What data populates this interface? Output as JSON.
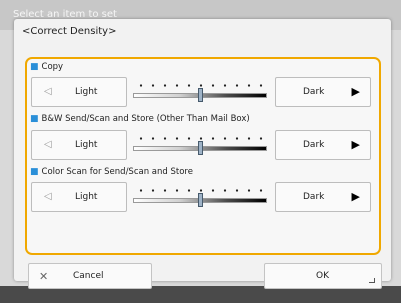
{
  "background": {
    "text": "Select an item to set"
  },
  "dialog": {
    "title": "<Correct Density>"
  },
  "sections": [
    {
      "label": "Copy",
      "light_label": "Light",
      "dark_label": "Dark",
      "level": 0.5
    },
    {
      "label": "B&W Send/Scan and Store (Other Than Mail Box)",
      "light_label": "Light",
      "dark_label": "Dark",
      "level": 0.5
    },
    {
      "label": "Color Scan for Send/Scan and Store",
      "light_label": "Light",
      "dark_label": "Dark",
      "level": 0.5
    }
  ],
  "icons": {
    "light": "light-icon",
    "dark": "dark-icon",
    "cancel": "close-icon",
    "ok": "corner-icon"
  },
  "footer": {
    "cancel_label": "Cancel",
    "ok_label": "OK"
  },
  "colors": {
    "highlight": "#f0a800",
    "bullet": "#2a8fd8",
    "dialog_bg": "#f2f2f2"
  }
}
